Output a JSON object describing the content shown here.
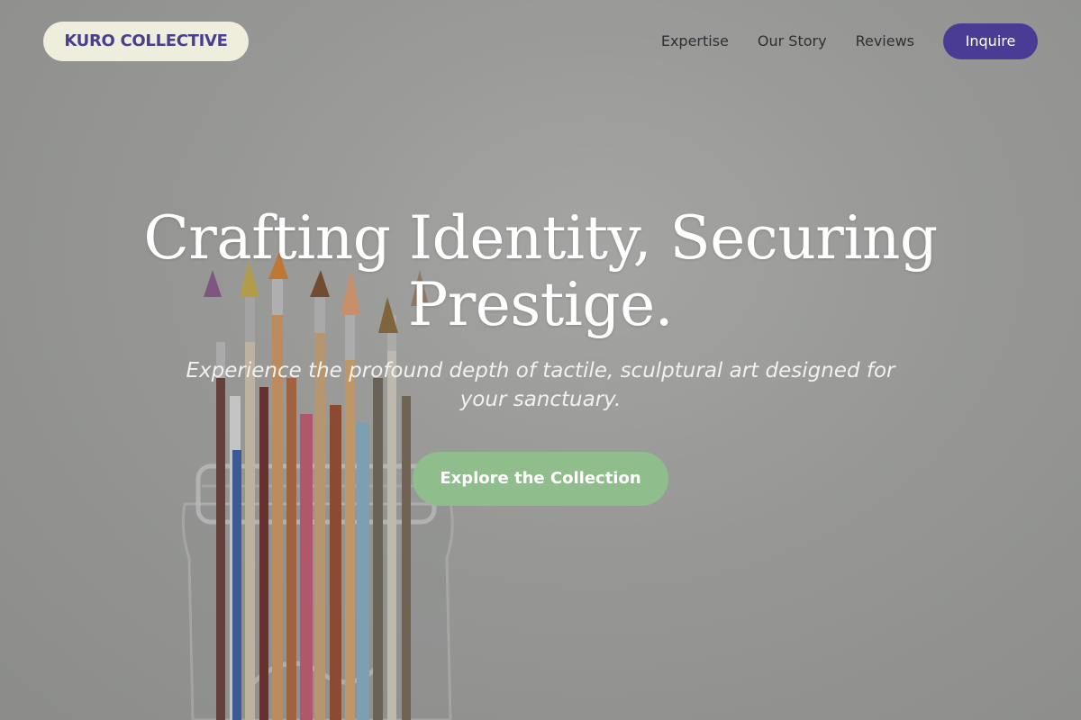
{
  "header": {
    "brand": "KURO COLLECTIVE",
    "nav_links": [
      "Expertise",
      "Our Story",
      "Reviews"
    ],
    "cta_label": "Inquire"
  },
  "hero": {
    "title": "Crafting Identity, Securing Prestige.",
    "subtitle": "Experience the profound depth of tactile, sculptural art designed for your sanctuary.",
    "cta_label": "Explore the Collection"
  },
  "colors": {
    "brand_pill_bg": "#efeedd",
    "brand_text": "#4a3f8f",
    "inquire_bg": "#4a3b94",
    "explore_bg": "#8fbd8c"
  }
}
